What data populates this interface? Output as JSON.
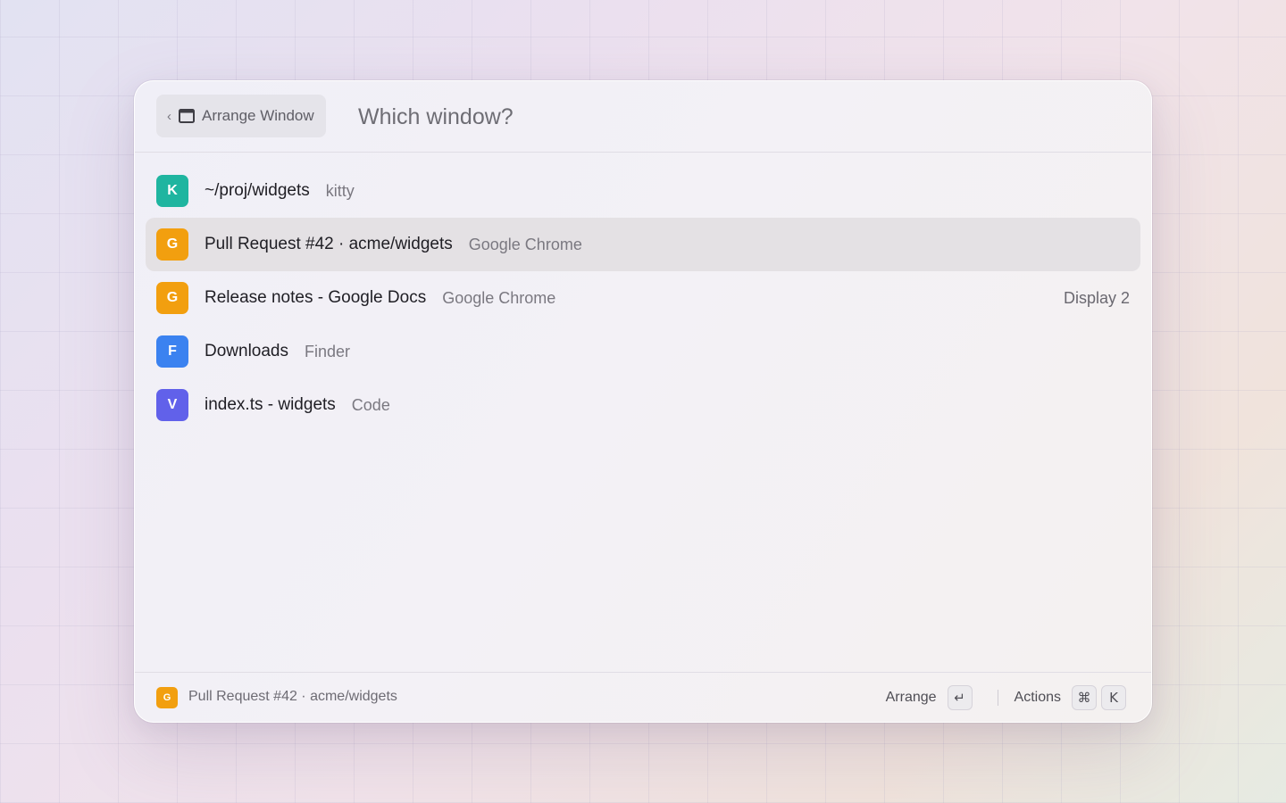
{
  "header": {
    "back_chevron": "‹",
    "back_label": "Arrange Window",
    "back_icon": "window-icon",
    "search_placeholder": "Which window?"
  },
  "items": [
    {
      "badge": "K",
      "badge_color": "#1fb5a0",
      "title": "~/proj/widgets",
      "subtitle": "kitty",
      "accessory": "",
      "selected": false
    },
    {
      "badge": "G",
      "badge_color": "#f29f0f",
      "title": "Pull Request #42 · acme/widgets",
      "subtitle": "Google Chrome",
      "accessory": "",
      "selected": true
    },
    {
      "badge": "G",
      "badge_color": "#f29f0f",
      "title": "Release notes - Google Docs",
      "subtitle": "Google Chrome",
      "accessory": "Display 2",
      "selected": false
    },
    {
      "badge": "F",
      "badge_color": "#3b82f0",
      "title": "Downloads",
      "subtitle": "Finder",
      "accessory": "",
      "selected": false
    },
    {
      "badge": "V",
      "badge_color": "#6161ea",
      "title": "index.ts - widgets",
      "subtitle": "Code",
      "accessory": "",
      "selected": false
    }
  ],
  "footer": {
    "badge": "G",
    "badge_color": "#f29f0f",
    "title": "Pull Request #42 · acme/widgets",
    "primary_action": "Arrange",
    "primary_key": "↵",
    "actions_label": "Actions",
    "actions_keys": [
      "⌘",
      "K"
    ]
  }
}
